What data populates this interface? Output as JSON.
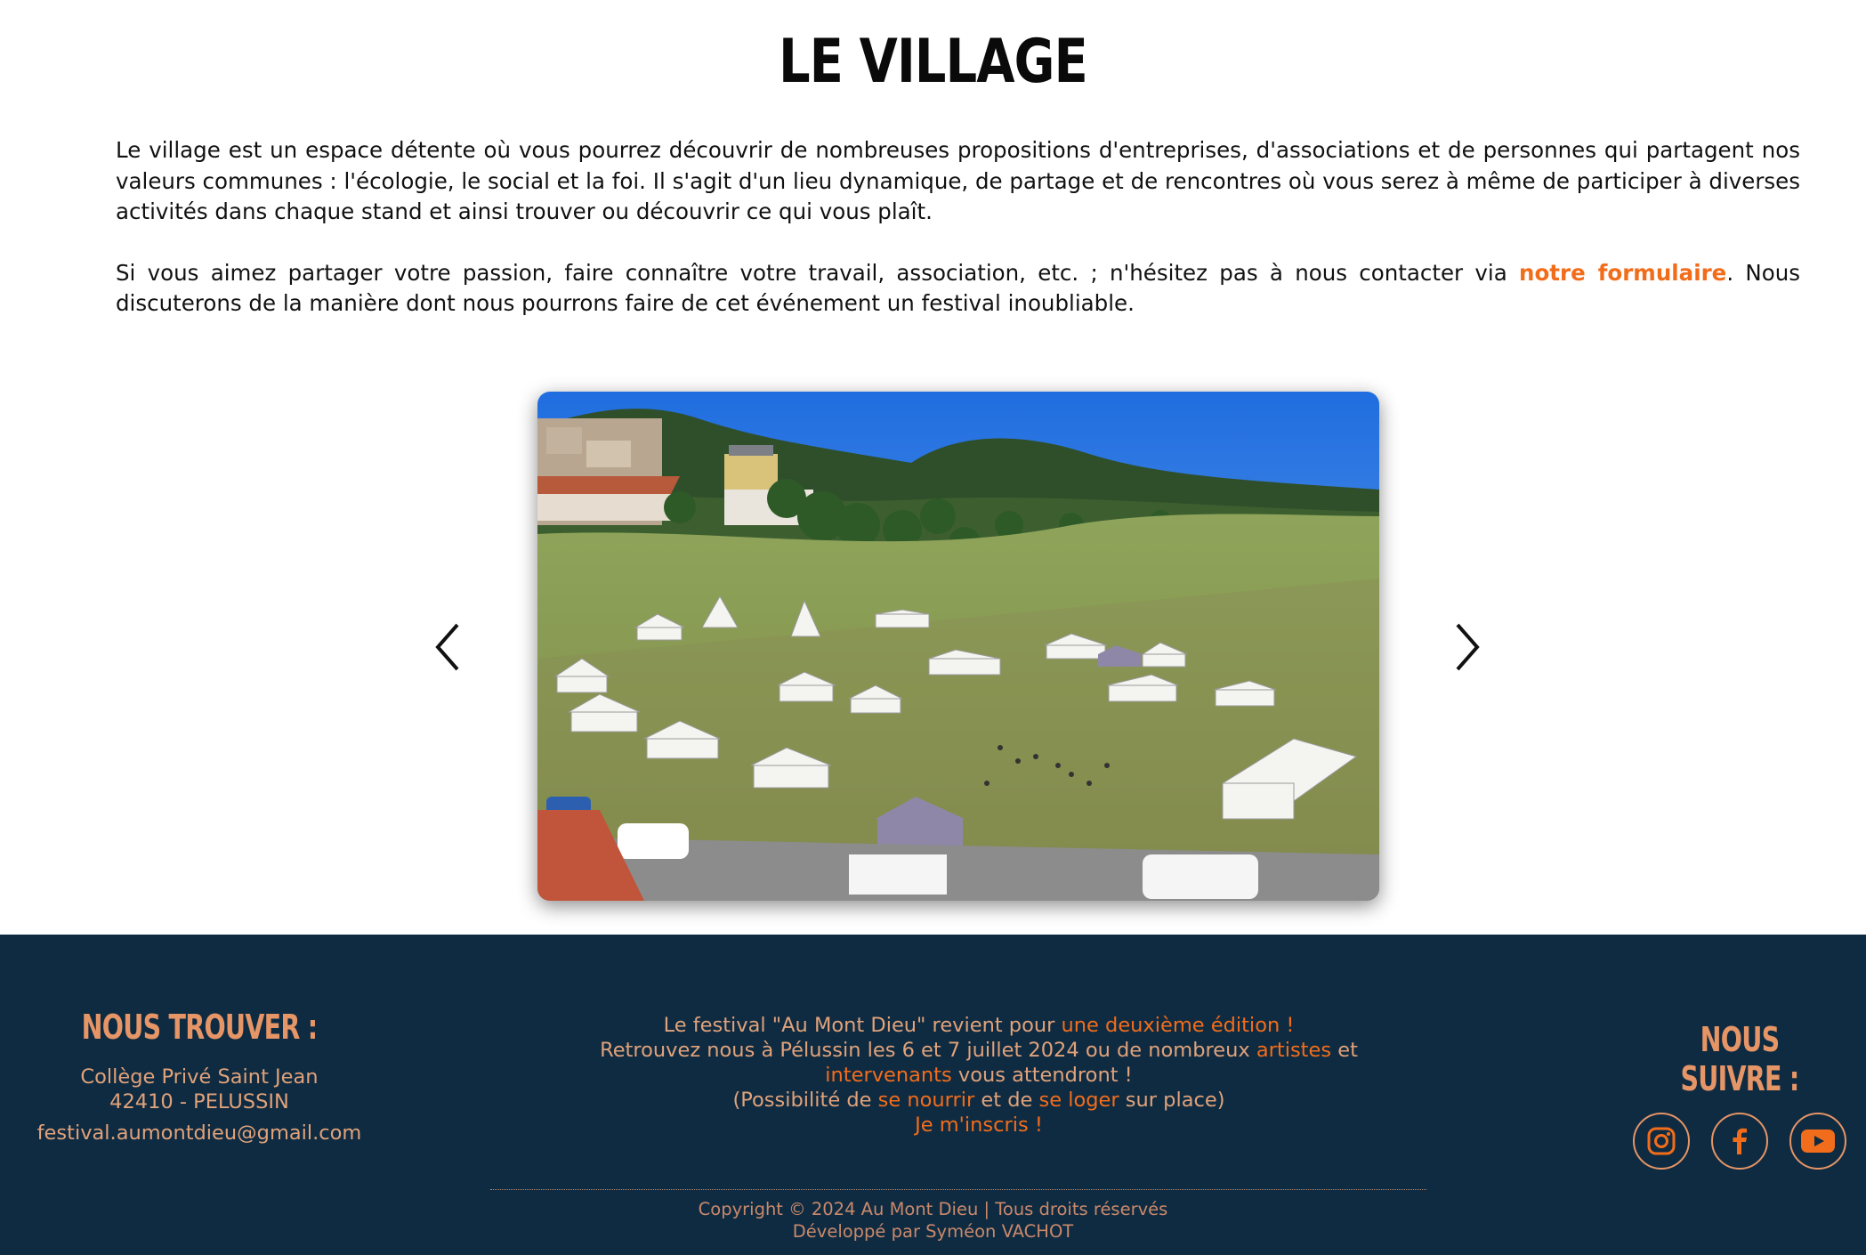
{
  "page": {
    "title": "LE VILLAGE"
  },
  "intro": {
    "p1": "Le village est un espace détente où vous pourrez découvrir de nombreuses propositions d'entreprises, d'associations et de personnes qui partagent nos valeurs communes : l'écologie, le social et la foi. Il s'agit d'un lieu dynamique, de partage et de rencontres où vous serez à même de participer à diverses activités dans chaque stand et ainsi trouver ou découvrir ce qui vous plaît.",
    "p2_before": "Si vous aimez partager votre passion, faire connaître votre travail, association, etc. ; n'hésitez pas à nous contacter via ",
    "p2_link": "notre formulaire",
    "p2_after": ". Nous discuterons de la manière dont nous pourrons faire de cet événement un festival inoubliable."
  },
  "carousel": {
    "prev_icon": "chevron-left-icon",
    "next_icon": "chevron-right-icon"
  },
  "footer": {
    "find_title": "NOUS TROUVER :",
    "address_line1": "Collège Privé Saint Jean",
    "address_line2": "42410 - PELUSSIN",
    "email": "festival.aumontdieu@gmail.com",
    "mid": {
      "l1_a": "Le festival \"Au Mont Dieu\" revient pour ",
      "l1_link": "une deuxième édition !",
      "l2_a": "Retrouvez nous à Pélussin les 6 et 7 juillet 2024 ou de nombreux ",
      "l2_link": "artistes",
      "l2_b": " et",
      "l3_link": "intervenants",
      "l3_b": " vous attendront !",
      "l4_a": "(Possibilité de ",
      "l4_link1": "se nourrir",
      "l4_b": " et de ",
      "l4_link2": "se loger",
      "l4_c": " sur place)",
      "l5_link": "Je m'inscris !"
    },
    "follow_title": "NOUS SUIVRE :",
    "socials": [
      "instagram-icon",
      "facebook-icon",
      "youtube-icon"
    ],
    "copyright": "Copyright © 2024 Au Mont Dieu | Tous droits réservés",
    "developer": "Développé par Syméon VACHOT"
  },
  "colors": {
    "accent": "#f26d1b",
    "footer_bg": "#0f2b42",
    "footer_text": "#e0a27a"
  }
}
